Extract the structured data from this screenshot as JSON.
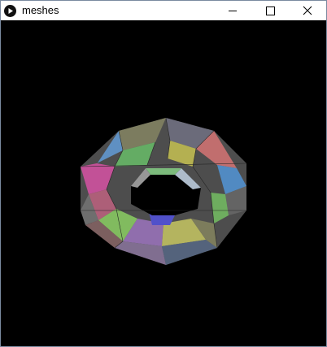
{
  "window": {
    "title": "meshes",
    "controls": {
      "minimize": "minimize-icon",
      "maximize": "maximize-icon",
      "close": "close-icon"
    }
  },
  "app_icon": "play-icon",
  "canvas": {
    "background": "#000000",
    "content": "3d-torus-mesh"
  }
}
